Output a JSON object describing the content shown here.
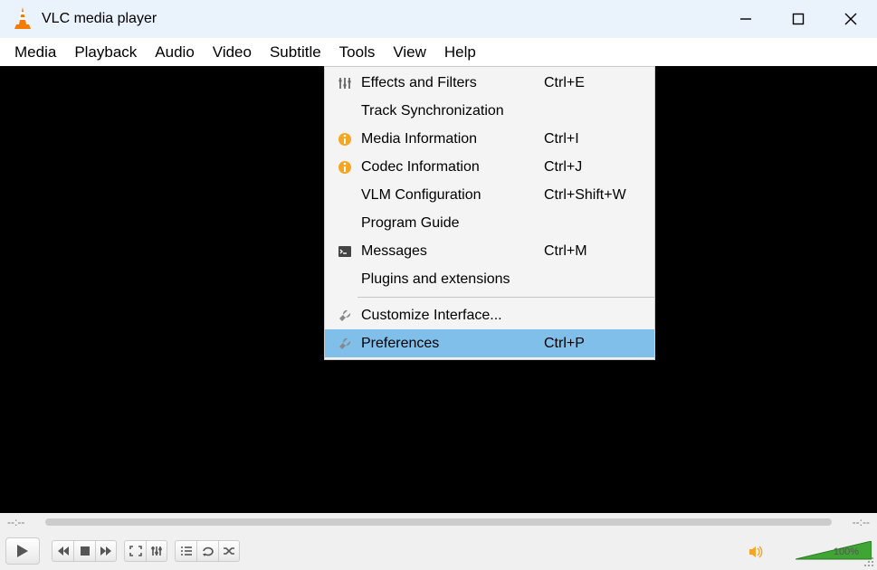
{
  "titlebar": {
    "title": "VLC media player"
  },
  "menubar": [
    "Media",
    "Playback",
    "Audio",
    "Video",
    "Subtitle",
    "Tools",
    "View",
    "Help"
  ],
  "dropdown": {
    "items": [
      {
        "icon": "sliders",
        "label": "Effects and Filters",
        "shortcut": "Ctrl+E"
      },
      {
        "icon": "",
        "label": "Track Synchronization",
        "shortcut": ""
      },
      {
        "icon": "info",
        "label": "Media Information",
        "shortcut": "Ctrl+I"
      },
      {
        "icon": "info",
        "label": "Codec Information",
        "shortcut": "Ctrl+J"
      },
      {
        "icon": "",
        "label": "VLM Configuration",
        "shortcut": "Ctrl+Shift+W"
      },
      {
        "icon": "",
        "label": "Program Guide",
        "shortcut": ""
      },
      {
        "icon": "terminal",
        "label": "Messages",
        "shortcut": "Ctrl+M"
      },
      {
        "icon": "",
        "label": "Plugins and extensions",
        "shortcut": ""
      }
    ],
    "items2": [
      {
        "icon": "wrench",
        "label": "Customize Interface...",
        "shortcut": ""
      },
      {
        "icon": "wrench",
        "label": "Preferences",
        "shortcut": "Ctrl+P",
        "highlight": true
      }
    ]
  },
  "seek": {
    "left_time": "--:--",
    "right_time": "--:--"
  },
  "volume": {
    "label": "100%"
  }
}
